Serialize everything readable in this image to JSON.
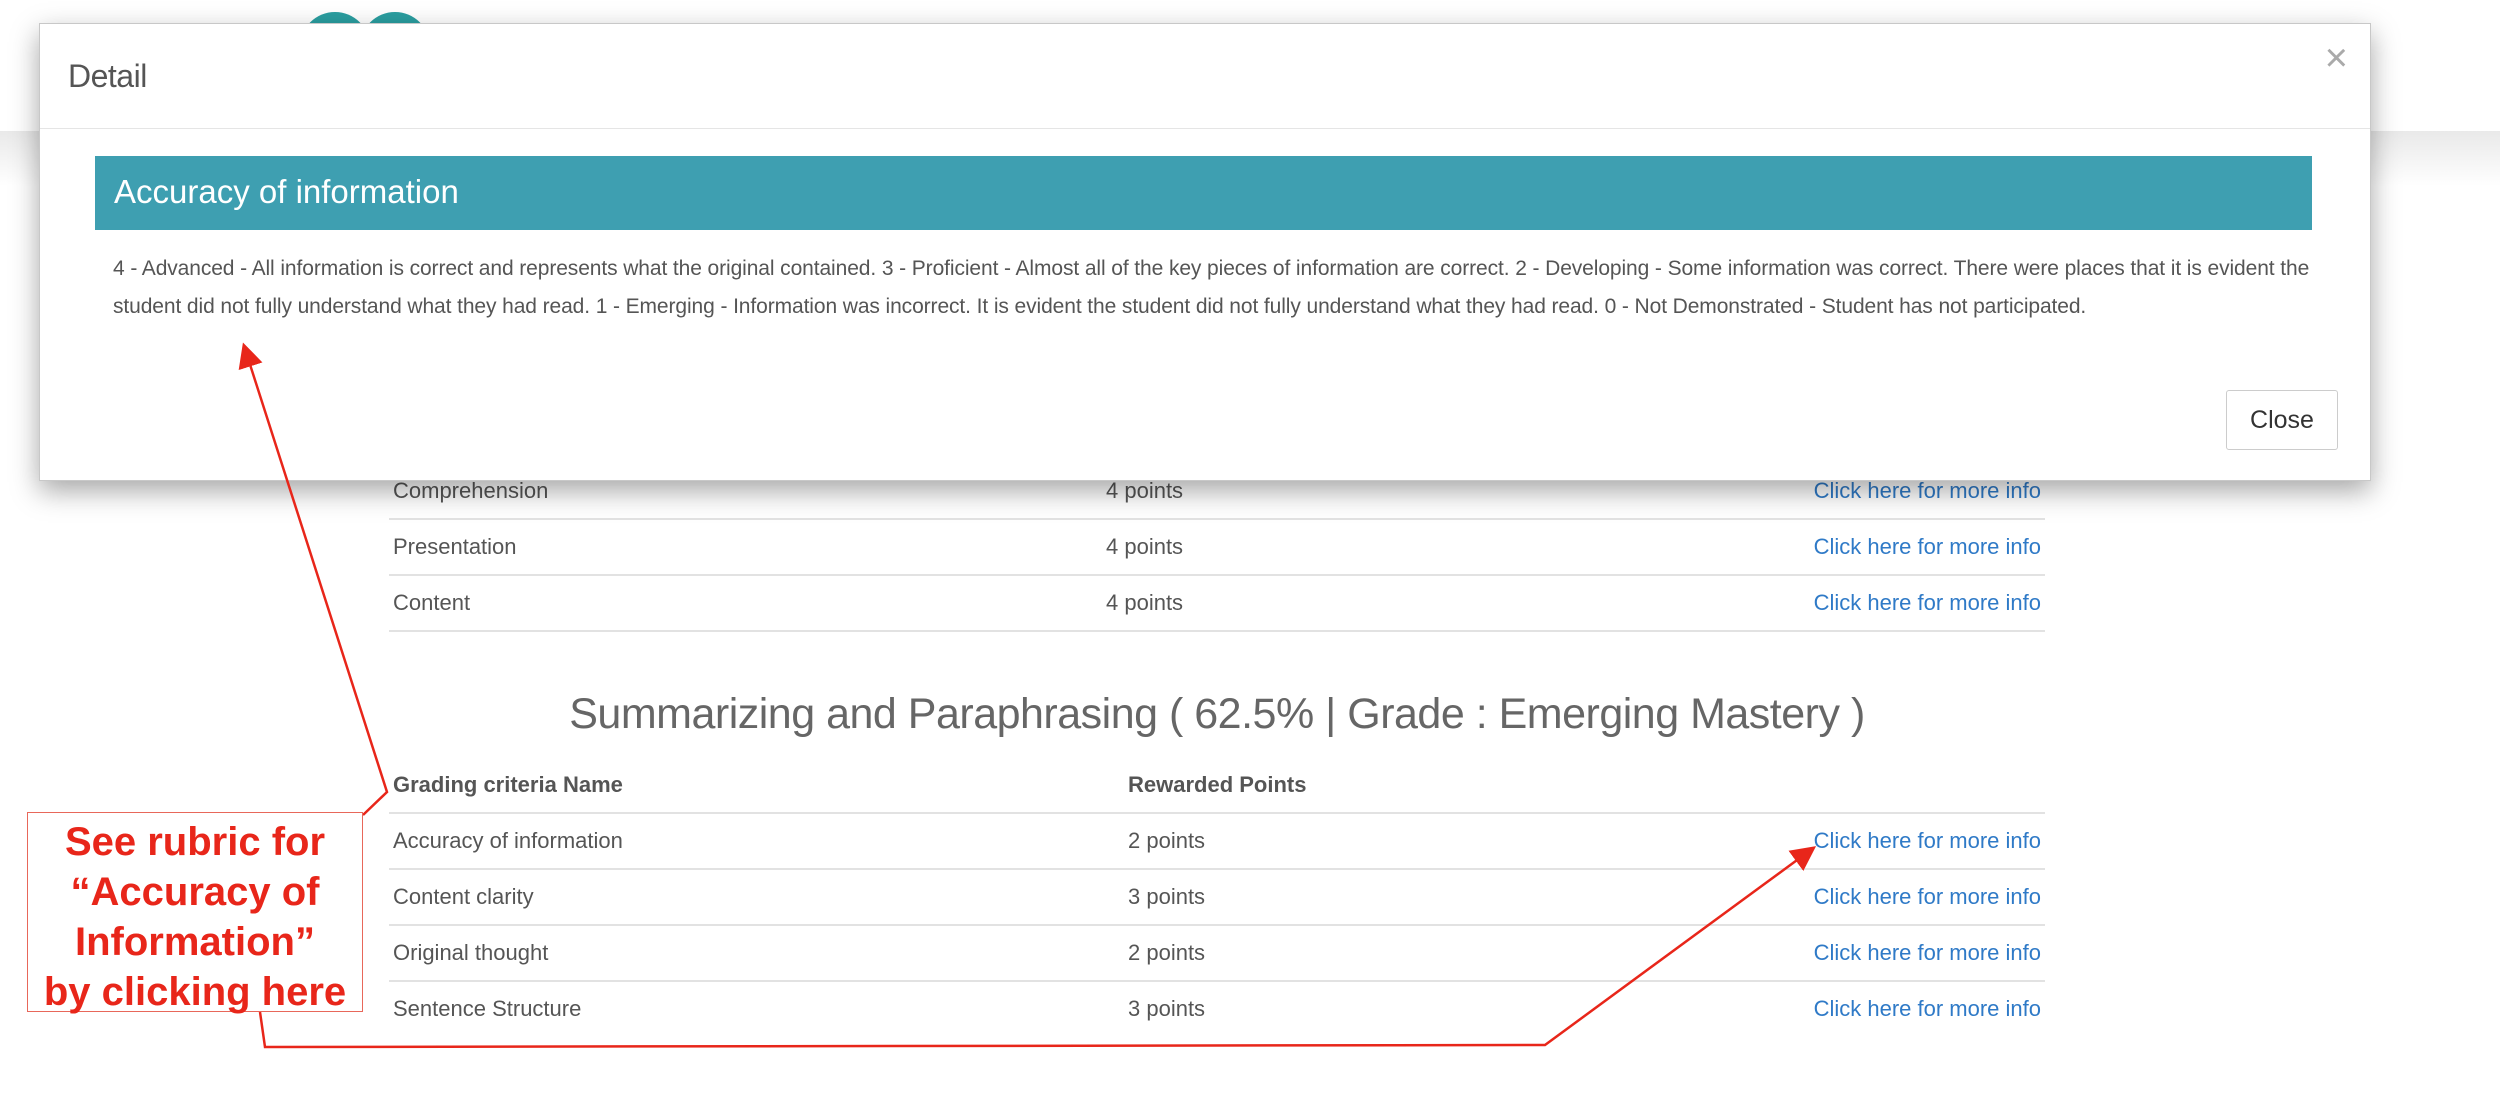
{
  "background": {
    "section1_rows": [
      {
        "name": "Comprehension",
        "points": "4 points",
        "link": "Click here for more info"
      },
      {
        "name": "Presentation",
        "points": "4 points",
        "link": "Click here for more info"
      },
      {
        "name": "Content",
        "points": "4 points",
        "link": "Click here for more info"
      }
    ],
    "section2": {
      "title": "Summarizing and Paraphrasing ( 62.5% | Grade : Emerging Mastery )",
      "header": {
        "name": "Grading criteria Name",
        "points": "Rewarded Points"
      },
      "rows": [
        {
          "name": "Accuracy of information",
          "points": "2 points",
          "link": "Click here for more info"
        },
        {
          "name": "Content clarity",
          "points": "3 points",
          "link": "Click here for more info"
        },
        {
          "name": "Original thought",
          "points": "2 points",
          "link": "Click here for more info"
        },
        {
          "name": "Sentence Structure",
          "points": "3 points",
          "link": "Click here for more info"
        }
      ]
    }
  },
  "modal": {
    "title": "Detail",
    "close_icon": "×",
    "criterion_title": "Accuracy of information",
    "criterion_description": "4 - Advanced - All information is correct and represents what the original contained. 3 - Proficient - Almost all of the key pieces of information are correct. 2 - Developing - Some information was correct. There were places that it is evident the student did not fully understand what they had read. 1 - Emerging - Information was incorrect. It is evident the student did not fully understand what they had read. 0 - Not Demonstrated - Student has not participated.",
    "close_button_label": "Close"
  },
  "annotation": {
    "callout_text": "See rubric for\n“Accuracy of\nInformation”\nby clicking here",
    "color": "#e8261a"
  },
  "colors": {
    "banner": "#3e9fb1",
    "link": "#2f7ac7",
    "avatar": "#2a9ea0"
  }
}
